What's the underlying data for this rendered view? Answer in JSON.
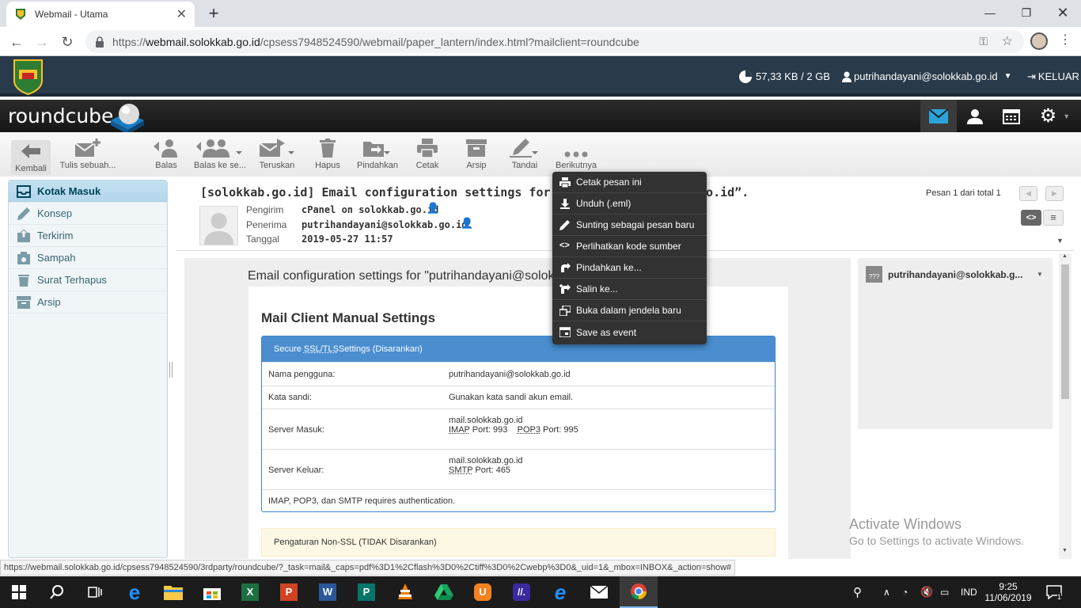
{
  "browser": {
    "tab_title": "Webmail - Utama",
    "url_prefix": "https://",
    "url_domain": "webmail.solokkab.go.id",
    "url_path": "/cpsess7948524590/webmail/paper_lantern/index.html?mailclient=roundcube"
  },
  "cpanel": {
    "quota": "57,33 KB / 2 GB",
    "user": "putrihandayani@solokkab.go.id",
    "logout": "KELUAR"
  },
  "roundcube": {
    "logo": "roundcube"
  },
  "toolbar": {
    "back": "Kembali",
    "compose": "Tulis sebuah...",
    "reply": "Balas",
    "reply_all": "Balas ke se...",
    "forward": "Teruskan",
    "delete": "Hapus",
    "move": "Pindahkan",
    "print": "Cetak",
    "archive": "Arsip",
    "mark": "Tandai",
    "more": "Berikutnya"
  },
  "folders": [
    {
      "label": "Kotak Masuk",
      "icon": "inbox-icon"
    },
    {
      "label": "Konsep",
      "icon": "pencil-icon"
    },
    {
      "label": "Terkirim",
      "icon": "sent-icon"
    },
    {
      "label": "Sampah",
      "icon": "junk-icon"
    },
    {
      "label": "Surat Terhapus",
      "icon": "trash-icon"
    },
    {
      "label": "Arsip",
      "icon": "archive-icon"
    }
  ],
  "message": {
    "subject": "[solokkab.go.id] Email configuration settings for “pu",
    "subject_tail": ".go.id”.",
    "from_label": "Pengirim",
    "from": "cPanel on solokkab.go.id",
    "to_label": "Penerima",
    "to": "putrihandayani@solokkab.go.id",
    "date_label": "Tanggal",
    "date": "2019-05-27 11:57",
    "counter": "Pesan 1 dari total 1"
  },
  "body": {
    "greeting": "Email configuration settings for \"putrihandayani@solok",
    "heading": "Mail Client Manual Settings",
    "ssl_title_pre": "Secure ",
    "ssl_title_abbr": "SSL/TLS",
    "ssl_title_post": " Settings (Disarankan)",
    "rows": {
      "username_k": "Nama pengguna:",
      "username_v": "putrihandayani@solokkab.go.id",
      "password_k": "Kata sandi:",
      "password_v": "Gunakan kata sandi akun email.",
      "incoming_k": "Server Masuk:",
      "incoming_host": "mail.solokkab.go.id",
      "imap": "IMAP",
      "imap_port": " Port: 993",
      "pop3": "POP3",
      "pop3_port": " Port: 995",
      "outgoing_k": "Server Keluar:",
      "outgoing_host": "mail.solokkab.go.id",
      "smtp": "SMTP",
      "smtp_port": " Port: 465",
      "auth_note": "IMAP, POP3, dan SMTP requires authentication."
    },
    "nonssl_title": "Pengaturan Non-SSL (TIDAK Disarankan)"
  },
  "contact": {
    "email": "putrihandayani@solokkab.g..."
  },
  "menu": [
    {
      "label": "Cetak pesan ini",
      "icon": "print-icon"
    },
    {
      "label": "Unduh (.eml)",
      "icon": "download-icon"
    },
    {
      "label": "Sunting sebagai pesan baru",
      "icon": "edit-icon"
    },
    {
      "label": "Perlihatkan kode sumber",
      "icon": "code-icon"
    },
    {
      "label": "Pindahkan ke...",
      "icon": "move-icon"
    },
    {
      "label": "Salin ke...",
      "icon": "copy-icon"
    },
    {
      "label": "Buka dalam jendela baru",
      "icon": "new-window-icon"
    },
    {
      "label": "Save as event",
      "icon": "calendar-icon"
    }
  ],
  "statusbar": "https://webmail.solokkab.go.id/cpsess7948524590/3rdparty/roundcube/?_task=mail&_caps=pdf%3D1%2Cflash%3D0%2Ctiff%3D0%2Cwebp%3D0&_uid=1&_mbox=INBOX&_action=show#",
  "watermark": {
    "line1": "Activate Windows",
    "line2": "Go to Settings to activate Windows."
  },
  "taskbar": {
    "lang": "IND",
    "time": "9:25",
    "date": "11/06/2019",
    "notif_count": "1"
  },
  "colors": {
    "cpanel_bg": "#293a4a",
    "ssl_blue": "#4a8ed0",
    "selected_folder": "#c3e2f3",
    "menu_bg": "#323232"
  }
}
